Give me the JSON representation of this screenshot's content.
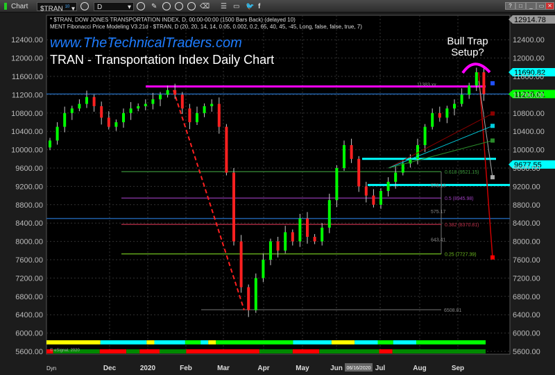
{
  "toolbar": {
    "app_label": "Chart",
    "symbol": "$TRAN",
    "symbol_badge": "10",
    "interval": "D",
    "window_buttons": [
      "?",
      "□",
      "_",
      "▭",
      "✕"
    ]
  },
  "header": {
    "line1": "* $TRAN, DOW JONES TRANSPORTATION INDEX, D, 00:00-00:00 (1500 Bars Back) (delayed 10)",
    "line2": "MENT Fibonacci Price Modeling V3.21d - $TRAN, D (20, 20, 14, 14, 0.05, 0.002, 0.2, 65, 40, 45, -45, Long, false, false, true, 7)"
  },
  "overlay": {
    "url": "www.TheTechnicalTraders.com",
    "title": "TRAN - Transportation Index Daily Chart",
    "annotation_line1": "Bull Trap",
    "annotation_line2": "Setup?"
  },
  "footer": {
    "copyright": "© eSignal, 2020",
    "dyn": "Dyn",
    "cursor_date": "06/16/2020"
  },
  "colors": {
    "up": "#00ff00",
    "down": "#ff2020",
    "magenta": "#ff00ff",
    "cyan": "#00ffff",
    "blue": "#1f5fa8"
  },
  "chart_data": {
    "type": "candlestick",
    "title": "TRAN - Transportation Index Daily Chart",
    "ylim": [
      5600,
      12400
    ],
    "y_ticks": [
      "12400.00",
      "12000.00",
      "11600.00",
      "11200.00",
      "10800.00",
      "10400.00",
      "10000.00",
      "9600.00",
      "9200.00",
      "8800.00",
      "8400.00",
      "8000.00",
      "7600.00",
      "7200.00",
      "6800.00",
      "6400.00",
      "6000.00",
      "5600.00"
    ],
    "x_ticks": [
      "Dec",
      "2020",
      "Feb",
      "Mar",
      "Apr",
      "May",
      "Jun",
      "Jul",
      "Aug",
      "Sep"
    ],
    "closes": [
      10200,
      10500,
      10800,
      10900,
      11000,
      11150,
      10950,
      10700,
      10500,
      10600,
      10800,
      10900,
      10950,
      11000,
      11100,
      11200,
      11300,
      11200,
      10900,
      10600,
      10800,
      10950,
      11000,
      10500,
      9500,
      8000,
      7000,
      6500,
      7200,
      7600,
      8000,
      7800,
      8200,
      8000,
      8500,
      8100,
      8000,
      8300,
      8900,
      9600,
      10100,
      9800,
      9200,
      9000,
      8800,
      9100,
      9300,
      9500,
      9700,
      9800,
      10100,
      10500,
      10800,
      10700,
      10900,
      11000,
      11200,
      11400,
      11690,
      11215
    ],
    "price_badges": [
      {
        "label": "12914.78",
        "value": 12914.78,
        "color": "#9a9a9a"
      },
      {
        "label": "11690.82",
        "value": 11690.82,
        "color": "#00ffff"
      },
      {
        "label": "11215.01",
        "value": 11215.01,
        "color": "#00ff00"
      },
      {
        "label": "9677.55",
        "value": 9677.55,
        "color": "#00ffff"
      }
    ],
    "fib_levels": [
      {
        "label": "0.618 (9521.15)",
        "value": 9521.15,
        "color": "#3fa03f"
      },
      {
        "label": "0.5 (8945.98)",
        "value": 8945.98,
        "color": "#a040c0"
      },
      {
        "label": "0.382 (8370.81)",
        "value": 8370.81,
        "color": "#c0304a"
      },
      {
        "label": "0.25 (7727.39)",
        "value": 7727.39,
        "color": "#70c020"
      }
    ],
    "range_labels": [
      {
        "label": "578.13",
        "value": 9230
      },
      {
        "label": "575.17",
        "value": 8660
      },
      {
        "label": "643.41",
        "value": 8050
      },
      {
        "label": "6508.81",
        "value": 6508.81
      },
      {
        "label": "11383.xx",
        "value": 11430
      }
    ],
    "top_bar_segments": [
      [
        "#ffff00",
        7
      ],
      [
        "#00ffff",
        6
      ],
      [
        "#ffff00",
        1
      ],
      [
        "#00ffff",
        4
      ],
      [
        "#00ff00",
        2
      ],
      [
        "#00ffff",
        1
      ],
      [
        "#ffff00",
        1
      ],
      [
        "#00ff00",
        10
      ],
      [
        "#00ffff",
        5
      ],
      [
        "#ffff00",
        3
      ],
      [
        "#00ffff",
        3
      ],
      [
        "#00ff00",
        2
      ],
      [
        "#00ffff",
        3
      ],
      [
        "#00ff00",
        9
      ]
    ],
    "bottom_bar_segments": [
      [
        "#ff0000",
        1
      ],
      [
        "#008800",
        7
      ],
      [
        "#ff0000",
        4
      ],
      [
        "#008800",
        2
      ],
      [
        "#ff0000",
        3
      ],
      [
        "#008800",
        4
      ],
      [
        "#ff0000",
        11
      ],
      [
        "#008800",
        5
      ],
      [
        "#ff0000",
        4
      ],
      [
        "#008800",
        9
      ],
      [
        "#ff0000",
        2
      ],
      [
        "#008800",
        14
      ]
    ]
  }
}
